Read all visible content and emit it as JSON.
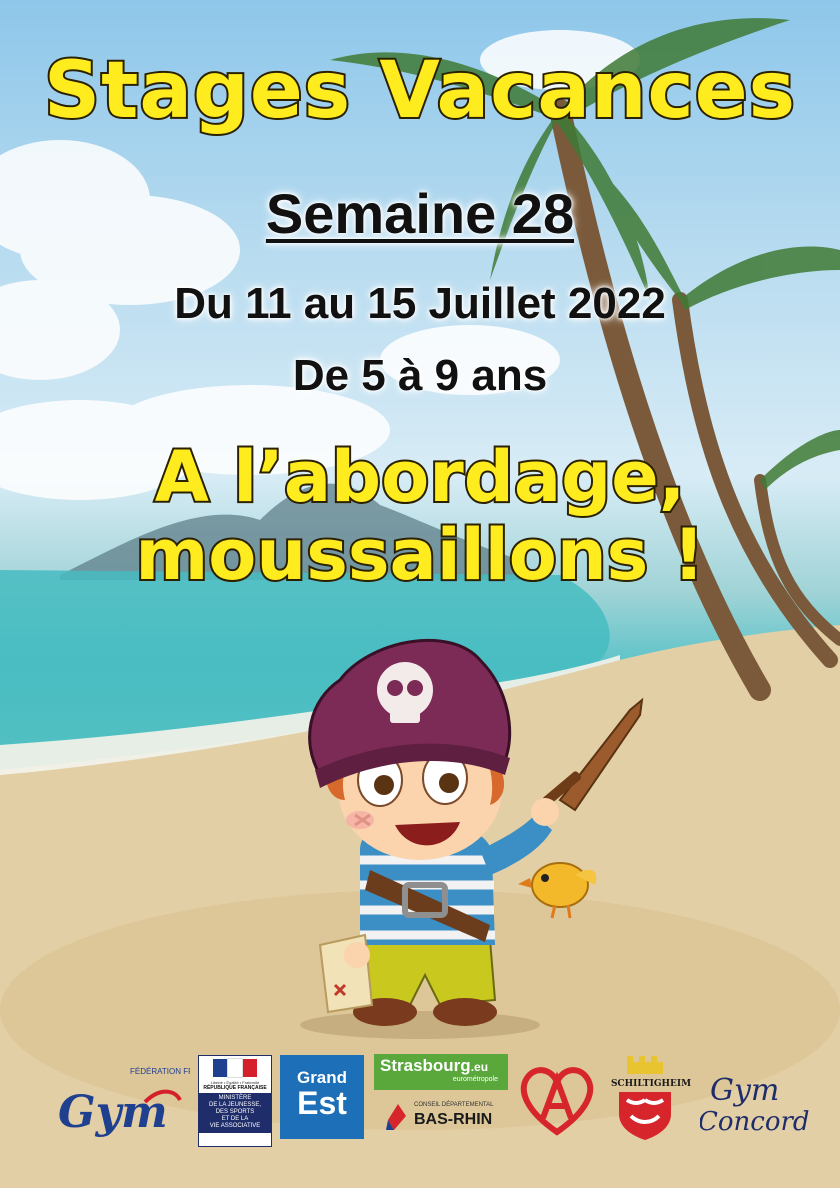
{
  "poster": {
    "title": "Stages Vacances",
    "week": "Semaine 28",
    "dates": "Du 11 au 15 Juillet 2022",
    "ages": "De 5 à 9 ans",
    "slogan_line1": "A l’abordage,",
    "slogan_line2": "moussaillons !"
  },
  "sponsors": {
    "ffg": {
      "small": "FÉDÉRATION FRANÇAISE",
      "name": "Gym"
    },
    "ministere": {
      "motto": "Liberté • Égalité • Fraternité",
      "rf": "RÉPUBLIQUE FRANÇAISE",
      "line1": "MINISTÈRE",
      "line2": "DE LA JEUNESSE,",
      "line3": "DES SPORTS",
      "line4": "ET DE LA",
      "line5": "VIE ASSOCIATIVE"
    },
    "grand_est": {
      "line1": "Grand",
      "line2": "Est"
    },
    "strasbourg": {
      "name": "Strasbourg",
      "tld": ".eu",
      "sub": "eurométropole"
    },
    "bas_rhin": {
      "small": "CONSEIL DÉPARTEMENTAL",
      "name": "BAS-RHIN"
    },
    "schiltigheim": {
      "name": "SCHILTIGHEIM"
    },
    "concordia": {
      "line1": "Gym",
      "line2": "Concordia"
    }
  },
  "colors": {
    "title_yellow": "#ffec1f",
    "outline": "#2b2100",
    "ffg_blue": "#1f3f8f",
    "ffg_red": "#d4202a",
    "grand_est_blue": "#1d6fb8",
    "strasbourg_green": "#5aa83c",
    "schiltigheim_red": "#d6262b"
  }
}
